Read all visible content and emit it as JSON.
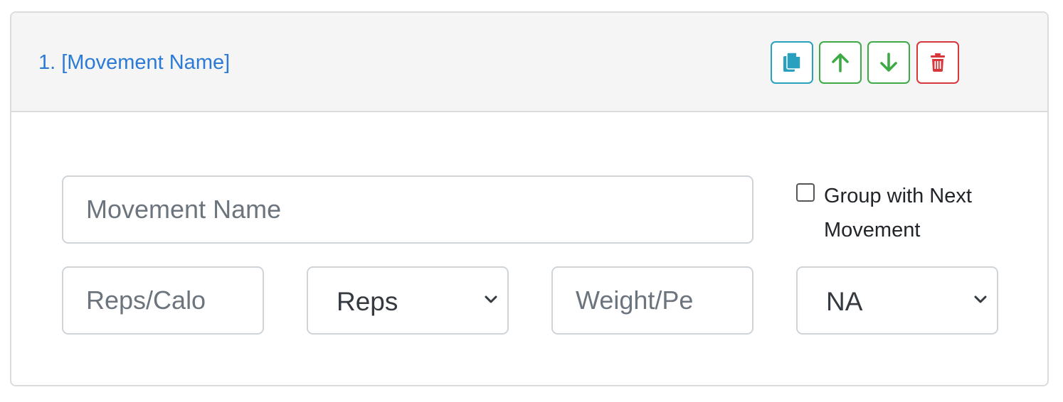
{
  "card": {
    "title": "1. [Movement Name]"
  },
  "actions": {
    "copy_icon": "copy-icon",
    "up_icon": "arrow-up-icon",
    "down_icon": "arrow-down-icon",
    "delete_icon": "trash-icon",
    "colors": {
      "copy": "#2aa0bf",
      "move": "#3eaa45",
      "delete": "#d8373c",
      "title": "#2b7bd6"
    }
  },
  "form": {
    "movement_name_placeholder": "Movement Name",
    "movement_name_value": "",
    "reps_placeholder": "Reps/Calo",
    "reps_value": "",
    "unit_selected": "Reps",
    "weight_placeholder": "Weight/Pe",
    "weight_value": "",
    "weight_unit_selected": "NA",
    "group_checkbox_label": "Group with Next Movement",
    "group_checked": false
  }
}
